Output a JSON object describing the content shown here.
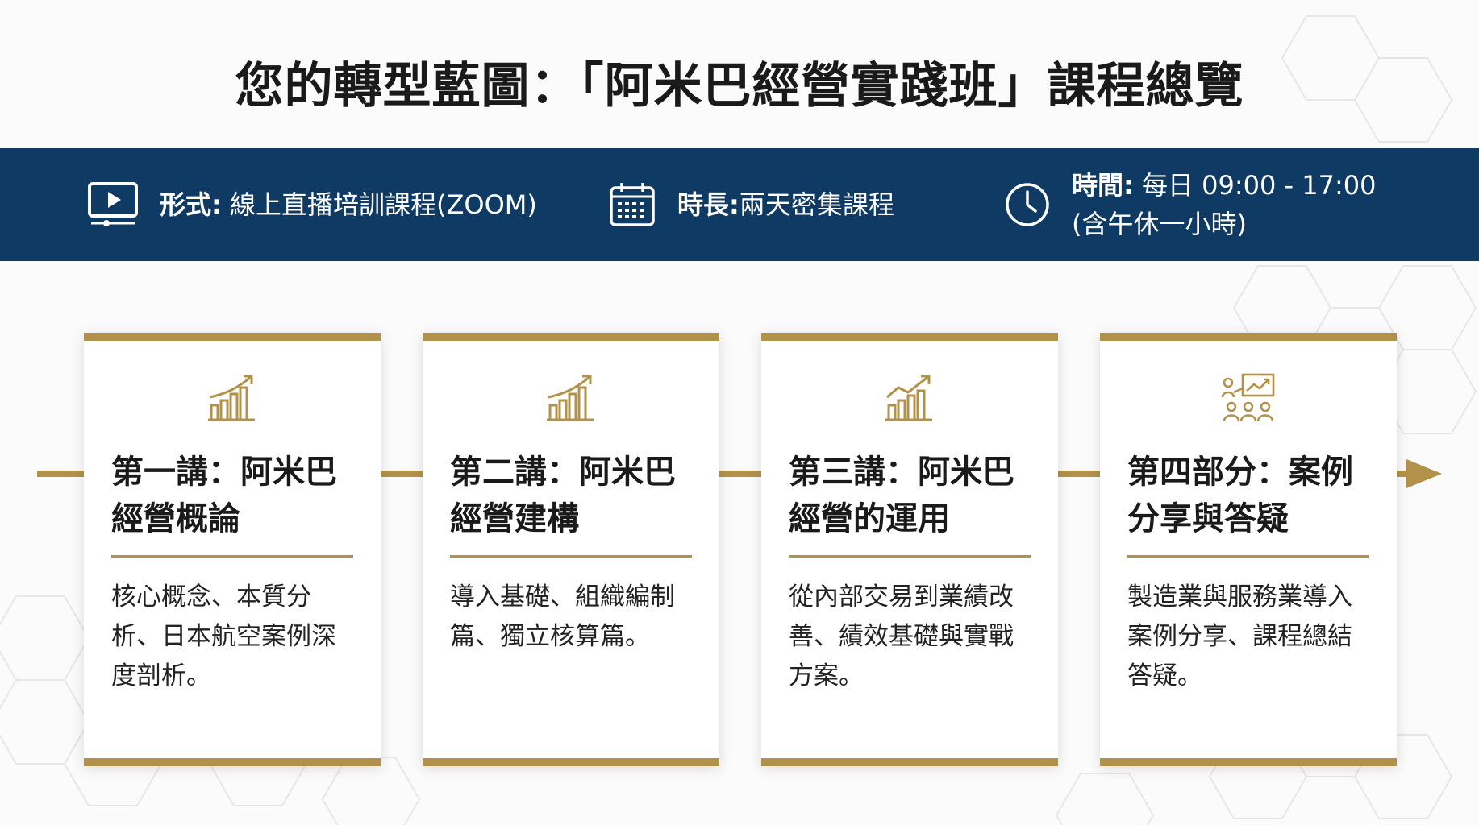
{
  "page": {
    "title": "您的轉型藍圖：「阿米巴經營實踐班」課程總覽"
  },
  "info_bar": {
    "format": {
      "label": "形式:",
      "value": " 線上直播培訓課程(ZOOM)",
      "icon": "video-player-icon"
    },
    "duration": {
      "label": "時長:",
      "value": "兩天密集課程",
      "icon": "calendar-icon"
    },
    "schedule": {
      "label": "時間:",
      "value": " 每日 09:00 - 17:00",
      "note": "(含午休一小時)",
      "icon": "clock-icon"
    }
  },
  "cards": [
    {
      "title_line1": "第一講：阿米巴",
      "title_line2": "經營概論",
      "desc_line1": "核心概念、本質分",
      "desc_line2": "析、日本航空案例深",
      "desc_line3": "度剖析。",
      "icon": "bar-chart-growth-icon"
    },
    {
      "title_line1": "第二講：阿米巴",
      "title_line2": "經營建構",
      "desc_line1": "導入基礎、組織編制",
      "desc_line2": "篇、獨立核算篇。",
      "desc_line3": "",
      "icon": "bar-chart-growth-icon"
    },
    {
      "title_line1": "第三講：阿米巴",
      "title_line2": "經營的運用",
      "desc_line1": "從內部交易到業績改",
      "desc_line2": "善、績效基礎與實戰",
      "desc_line3": "方案。",
      "icon": "line-chart-growth-icon"
    },
    {
      "title_line1": "第四部分：案例",
      "title_line2": "分享與答疑",
      "desc_line1": "製造業與服務業導入",
      "desc_line2": "案例分享、課程總結",
      "desc_line3": "答疑。",
      "icon": "team-presentation-icon"
    }
  ],
  "colors": {
    "navy": "#0f3a63",
    "gold": "#b2924a",
    "text": "#1d1d1d",
    "background": "#fbfbfb"
  }
}
